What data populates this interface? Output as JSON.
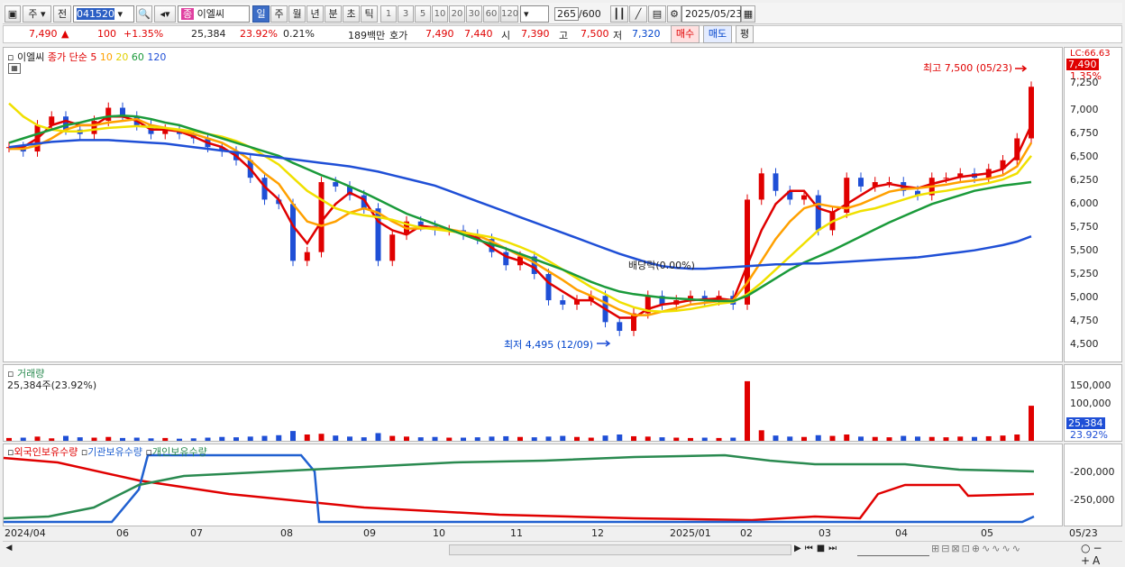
{
  "toolbar": {
    "period_type": "주",
    "prev_label": "전",
    "code": "041520",
    "stock_name": "이엘씨",
    "period_tabs": [
      "일",
      "주",
      "월",
      "년",
      "분",
      "초",
      "틱"
    ],
    "active_period": "일",
    "intervals": [
      "1",
      "3",
      "5",
      "10",
      "20",
      "30",
      "60",
      "120"
    ],
    "count": "265",
    "count_total": "/600",
    "date": "2025/05/23"
  },
  "quote": {
    "price": "7,490",
    "change": "100",
    "change_pct": "+1.35%",
    "volume": "25,384",
    "turnover": "23.92%",
    "ratio": "0.21%",
    "amount": "189백만",
    "hoga_label": "호가",
    "ask": "7,490",
    "bid": "7,440",
    "open_label": "시",
    "open": "7,390",
    "high_label": "고",
    "high": "7,500",
    "low_label": "저",
    "low": "7,320",
    "buy_label": "매수",
    "sell_label": "매도",
    "eval_label": "평"
  },
  "price_panel": {
    "stock_name": "이엘씨",
    "legend_prefix": "종가 단순",
    "ma_periods": [
      "5",
      "10",
      "20",
      "60",
      "120"
    ],
    "ma_colors": [
      "#e00000",
      "#ffa000",
      "#f0e000",
      "#1a9a3a",
      "#1f4fd6"
    ],
    "high_annotation": "최고 7,500 (05/23)",
    "low_annotation": "최저 4,495 (12/09)",
    "dividend_annotation": "배당락(0.00%)"
  },
  "price_axis": {
    "top_label": "LC:66.63",
    "last_price": "7,490",
    "last_pct": "1.35%",
    "ticks": [
      "7,250",
      "7,000",
      "6,750",
      "6,500",
      "6,250",
      "6,000",
      "5,750",
      "5,500",
      "5,250",
      "5,000",
      "4,750",
      "4,500"
    ]
  },
  "volume_panel": {
    "title": "거래량",
    "value_text": "25,384주(23.92%)",
    "ticks": [
      "150,000",
      "100,000"
    ],
    "last_volume": "25,384",
    "last_pct": "23.92%"
  },
  "holdings_panel": {
    "legend": [
      "외국인보유수량",
      "기관보유수량",
      "개인보유수량"
    ],
    "colors": [
      "#e00000",
      "#2060d0",
      "#2a8a50"
    ],
    "ticks": [
      "-200,000",
      "-250,000"
    ]
  },
  "x_axis": {
    "labels": [
      "2024/04",
      "06",
      "07",
      "08",
      "09",
      "10",
      "11",
      "12",
      "2025/01",
      "02",
      "03",
      "04",
      "05"
    ],
    "right_date": "05/23"
  },
  "chart_data": {
    "type": "line",
    "title": "이엘씨",
    "ylim": [
      4350,
      7750
    ],
    "series": [
      {
        "name": "종가",
        "values": [
          6800,
          6750,
          7050,
          7150,
          7000,
          6950,
          7100,
          7250,
          7150,
          7050,
          6950,
          7000,
          6950,
          6900,
          6800,
          6750,
          6650,
          6450,
          6200,
          6150,
          5500,
          5600,
          6400,
          6350,
          6250,
          6100,
          5500,
          5800,
          5950,
          5900,
          5850,
          5850,
          5800,
          5750,
          5600,
          5450,
          5550,
          5350,
          5050,
          5000,
          5050,
          5100,
          4800,
          4700,
          4900,
          5100,
          5000,
          5050,
          5100,
          5050,
          5100,
          5000,
          6200,
          6500,
          6300,
          6200,
          6250,
          5850,
          6050,
          6450,
          6350,
          6400,
          6400,
          6300,
          6250,
          6450,
          6450,
          6500,
          6450,
          6550,
          6650,
          6900,
          7490
        ]
      },
      {
        "name": "5",
        "values": [
          6780,
          6800,
          6900,
          7050,
          7100,
          7050,
          7050,
          7150,
          7150,
          7100,
          7000,
          7000,
          6980,
          6920,
          6850,
          6800,
          6700,
          6550,
          6350,
          6200,
          5900,
          5700,
          5950,
          6150,
          6280,
          6200,
          5950,
          5850,
          5800,
          5900,
          5880,
          5850,
          5810,
          5760,
          5650,
          5550,
          5500,
          5420,
          5250,
          5150,
          5050,
          5050,
          4950,
          4850,
          4850,
          4950,
          5000,
          5020,
          5050,
          5060,
          5070,
          5050,
          5450,
          5850,
          6150,
          6300,
          6300,
          6100,
          6050,
          6150,
          6250,
          6350,
          6380,
          6350,
          6330,
          6380,
          6420,
          6460,
          6480,
          6500,
          6550,
          6700,
          7050
        ]
      },
      {
        "name": "10",
        "values": [
          6780,
          6780,
          6820,
          6900,
          7000,
          7050,
          7050,
          7080,
          7100,
          7120,
          7050,
          7020,
          6990,
          6950,
          6900,
          6850,
          6760,
          6650,
          6500,
          6380,
          6150,
          5950,
          5900,
          5950,
          6050,
          6100,
          6050,
          5950,
          5870,
          5870,
          5880,
          5860,
          5830,
          5790,
          5720,
          5640,
          5560,
          5480,
          5380,
          5280,
          5170,
          5100,
          5020,
          4940,
          4880,
          4880,
          4920,
          4960,
          5000,
          5020,
          5040,
          5050,
          5250,
          5500,
          5750,
          5950,
          6100,
          6150,
          6120,
          6100,
          6150,
          6220,
          6290,
          6320,
          6330,
          6350,
          6370,
          6400,
          6420,
          6440,
          6480,
          6580,
          6850
        ]
      },
      {
        "name": "20",
        "values": [
          7300,
          7150,
          7050,
          7000,
          6980,
          6980,
          7000,
          7020,
          7030,
          7040,
          7030,
          7020,
          7000,
          6980,
          6950,
          6920,
          6870,
          6800,
          6700,
          6600,
          6450,
          6300,
          6200,
          6100,
          6050,
          6020,
          6000,
          5970,
          5920,
          5880,
          5860,
          5840,
          5820,
          5800,
          5770,
          5720,
          5660,
          5590,
          5500,
          5400,
          5300,
          5200,
          5120,
          5030,
          4970,
          4930,
          4920,
          4930,
          4950,
          4980,
          5010,
          5030,
          5120,
          5250,
          5400,
          5550,
          5700,
          5850,
          5950,
          6020,
          6070,
          6100,
          6150,
          6200,
          6250,
          6280,
          6300,
          6330,
          6360,
          6390,
          6430,
          6500,
          6700
        ]
      },
      {
        "name": "60",
        "values": [
          6850,
          6900,
          6950,
          7000,
          7050,
          7080,
          7120,
          7150,
          7160,
          7150,
          7120,
          7080,
          7050,
          7000,
          6950,
          6900,
          6850,
          6800,
          6750,
          6700,
          6620,
          6550,
          6480,
          6420,
          6350,
          6280,
          6200,
          6120,
          6040,
          5980,
          5920,
          5860,
          5800,
          5740,
          5690,
          5640,
          5580,
          5520,
          5460,
          5400,
          5330,
          5260,
          5200,
          5150,
          5120,
          5100,
          5080,
          5070,
          5060,
          5050,
          5040,
          5040,
          5100,
          5200,
          5300,
          5400,
          5480,
          5550,
          5620,
          5700,
          5780,
          5860,
          5940,
          6010,
          6080,
          6150,
          6200,
          6250,
          6300,
          6330,
          6360,
          6380,
          6400
        ]
      },
      {
        "name": "120",
        "values": [
          6800,
          6820,
          6840,
          6860,
          6870,
          6880,
          6880,
          6880,
          6870,
          6860,
          6850,
          6840,
          6820,
          6800,
          6780,
          6760,
          6740,
          6720,
          6700,
          6680,
          6660,
          6640,
          6620,
          6600,
          6580,
          6550,
          6520,
          6480,
          6440,
          6400,
          6360,
          6300,
          6240,
          6180,
          6120,
          6060,
          6000,
          5940,
          5880,
          5820,
          5760,
          5700,
          5640,
          5580,
          5530,
          5480,
          5440,
          5420,
          5410,
          5410,
          5420,
          5430,
          5440,
          5450,
          5460,
          5460,
          5470,
          5470,
          5480,
          5490,
          5500,
          5510,
          5520,
          5530,
          5540,
          5560,
          5580,
          5600,
          5620,
          5650,
          5680,
          5720,
          5780
        ]
      }
    ],
    "volume": [
      8000,
      9000,
      12000,
      7000,
      14000,
      10000,
      9000,
      11000,
      8000,
      9000,
      7000,
      8000,
      6000,
      7000,
      9000,
      11000,
      10000,
      12000,
      14000,
      16000,
      28000,
      18000,
      20000,
      15000,
      12000,
      10000,
      22000,
      14000,
      12000,
      10000,
      11000,
      9000,
      9000,
      10000,
      12000,
      13000,
      11000,
      10000,
      12000,
      14000,
      11000,
      9000,
      15000,
      18000,
      13000,
      12000,
      10000,
      9000,
      8000,
      9000,
      8000,
      9000,
      170000,
      30000,
      15000,
      12000,
      11000,
      16000,
      14000,
      18000,
      12000,
      11000,
      10000,
      14000,
      12000,
      11000,
      10000,
      12000,
      11000,
      13000,
      15000,
      18000,
      100000
    ]
  }
}
